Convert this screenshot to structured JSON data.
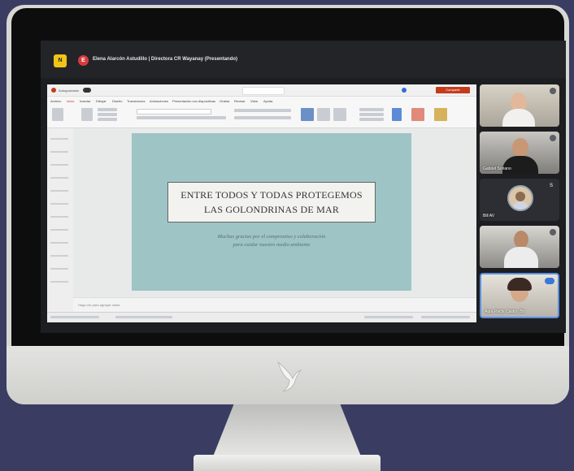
{
  "meeting": {
    "app_badge": "🟨",
    "presenter_initial": "E",
    "presenter_title": "Elena Alarcón Astudillo | Directora CR Wayanay (Presentando)"
  },
  "powerpoint": {
    "share_button": "Compartir",
    "tabs": [
      "Archivo",
      "Inicio",
      "Insertar",
      "Dibujar",
      "Diseño",
      "Transiciones",
      "Animaciones",
      "Presentación con diapositivas",
      "Grabar",
      "Revisar",
      "Vista",
      "Ayuda"
    ],
    "autosave_label": "Autoguardado",
    "notes_placeholder": "Haga clic para agregar notas",
    "slide": {
      "title_line1": "ENTRE TODOS Y TODAS PROTEGEMOS",
      "title_line2": "LAS GOLONDRINAS DE MAR",
      "subtitle_line1": "Muchas gracias por el compromiso y colaboración",
      "subtitle_line2": "para cuidar nuestro medio ambiente"
    }
  },
  "participants": [
    {
      "name": "",
      "initial": ""
    },
    {
      "name": "Gabriel Soriano",
      "initial": ""
    },
    {
      "name": "Bill AV",
      "initial": "S"
    },
    {
      "name": "",
      "initial": ""
    },
    {
      "name": "Aura Pachi Castro (Bo",
      "initial": ""
    }
  ],
  "colors": {
    "background": "#3a3c62",
    "slide_bg": "#9ec4c6",
    "share_button": "#c43b1c",
    "app_badge": "#f0c419"
  }
}
